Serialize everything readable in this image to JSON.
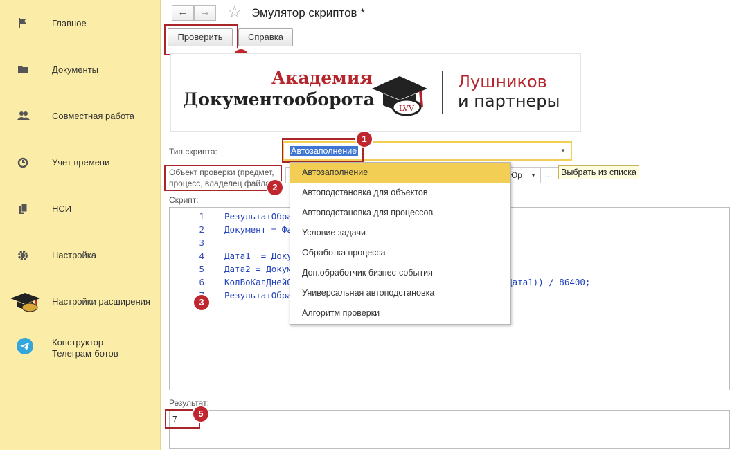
{
  "sidebar": {
    "items": [
      {
        "label": "Главное",
        "icon": "flag-icon"
      },
      {
        "label": "Документы",
        "icon": "folder-icon"
      },
      {
        "label": "Совместная работа",
        "icon": "users-icon"
      },
      {
        "label": "Учет времени",
        "icon": "clock-icon"
      },
      {
        "label": "НСИ",
        "icon": "books-icon"
      },
      {
        "label": "Настройка",
        "icon": "gear-icon"
      },
      {
        "label": "Настройки расширения",
        "icon": "graduation-cap-icon"
      },
      {
        "label": "Конструктор\nТелеграм-ботов",
        "icon": "telegram-icon"
      }
    ]
  },
  "header": {
    "title": "Эмулятор скриптов *",
    "back": "←",
    "forward": "→",
    "star": "☆"
  },
  "toolbar": {
    "check_label": "Проверить",
    "help_label": "Справка"
  },
  "logo": {
    "line1": "Академия",
    "line2": "Документооборота",
    "line3": "Лушников",
    "line4": "и партнеры",
    "seal": "LVV"
  },
  "form": {
    "script_type_label": "Тип скрипта:",
    "script_type_value": "Автозаполнение",
    "object_label_1": "Объект проверки (предмет,",
    "object_label_2": "процесс, владелец файла)",
    "object_partial": "Юр",
    "ellipsis": "...",
    "tooltip": "Выбрать из списка",
    "script_label": "Скрипт:",
    "result_label": "Результат:",
    "result_value": "7"
  },
  "script": {
    "lines": [
      {
        "n": "1",
        "code": "РезультатОбра"
      },
      {
        "n": "2",
        "code": "Документ = Фа"
      },
      {
        "n": "3",
        "code": ""
      },
      {
        "n": "4",
        "code": "Дата1  = Доку"
      },
      {
        "n": "5",
        "code": "Дата2 = Докум"
      },
      {
        "n": "6",
        "code": "КолВоКалДнейО"
      },
      {
        "n": "7",
        "code": "РезультатОбра"
      }
    ],
    "line6_tail": "а(Дата1)) / 86400;"
  },
  "dropdown": {
    "options": [
      "Автозаполнение",
      "Автоподстановка для объектов",
      "Автоподстановка для процессов",
      "Условие задачи",
      "Обработка процесса",
      "Доп.обработчик бизнес-события",
      "Универсальная автоподстановка",
      "Алгоритм проверки"
    ],
    "selected": 0
  },
  "badges": [
    "1",
    "2",
    "3",
    "4",
    "5"
  ],
  "colors": {
    "sidebar_bg": "#fbeda7",
    "accent_yellow": "#f2cf54",
    "annotation_red": "#c0262d",
    "code_blue": "#2141bd"
  }
}
